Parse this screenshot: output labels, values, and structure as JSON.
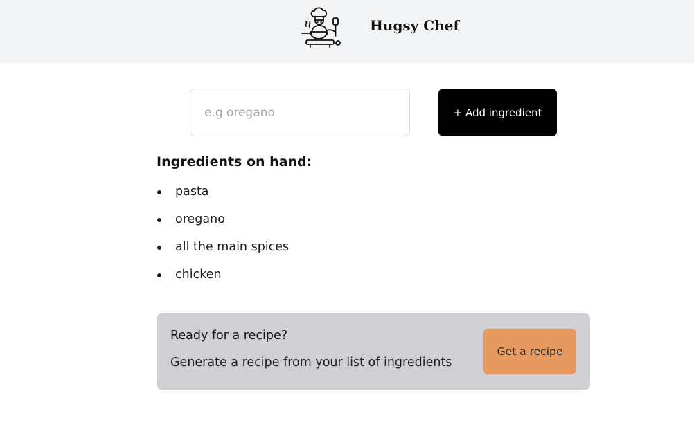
{
  "header": {
    "title": "Hugsy Chef",
    "logo_icon": "chef-cooking-icon"
  },
  "form": {
    "input_placeholder": "e.g oregano",
    "input_value": "",
    "add_button_label": "+ Add ingredient"
  },
  "ingredients": {
    "heading": "Ingredients on hand:",
    "items": [
      "pasta",
      "oregano",
      "all the main spices",
      "chicken"
    ]
  },
  "recipe_panel": {
    "title": "Ready for a recipe?",
    "subtitle": "Generate a recipe from your list of ingredients",
    "button_label": "Get a recipe"
  },
  "colors": {
    "header_bg": "#f3f4f5",
    "add_button_bg": "#000000",
    "panel_bg": "#d0d0d4",
    "recipe_button_bg": "#e79a60"
  }
}
